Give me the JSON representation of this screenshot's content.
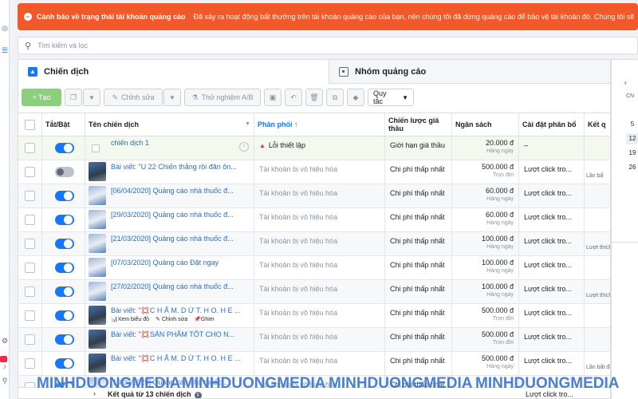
{
  "alert": {
    "title": "Cảnh báo về trạng thái tài khoản quảng cáo",
    "message": "Đã xảy ra hoạt động bất thường trên tài khoản quảng cáo của bạn, nên chúng tôi đã dừng quảng cáo để bảo vệ tài khoản đó. Chúng tôi sẽ"
  },
  "search": {
    "placeholder": "Tìm kiếm và lọc"
  },
  "tabs": {
    "campaigns": "Chiến dịch",
    "ad_sets": "Nhóm quảng cáo"
  },
  "toolbar": {
    "create": "+ Tạo",
    "edit": "Chỉnh sửa",
    "ab_test": "Thử nghiệm A/B",
    "rules": "Quy tắc"
  },
  "columns": {
    "on_off": "Tắt/Bật",
    "name": "Tên chiến dịch",
    "delivery": "Phân phối ↑",
    "bid": "Chiến lược giá thầu",
    "budget": "Ngân sách",
    "optimization": "Cài đặt phân bổ",
    "results": "Kết q"
  },
  "rows": [
    {
      "name": "chiến dịch 1",
      "sub": "",
      "delivery": "Lỗi thiết lập",
      "delivery_error": true,
      "bid": "Giới hạn giá thầu",
      "budget": "20.000 đ",
      "budget_type": "Hàng ngày",
      "opt": "–",
      "result": "",
      "toggle": "on",
      "thumb": "draft"
    },
    {
      "name": "Bài viết: \"U 22 Chiến thắng rồi đăn ôn...",
      "sub": "",
      "delivery": "Tài khoản bị vô hiệu hóa",
      "delivery_error": false,
      "bid": "Chi phí thấp nhất",
      "budget": "500.000 đ",
      "budget_type": "Trọn đời",
      "opt": "Lượt click tro...",
      "result": "Lần bấ",
      "toggle": "off",
      "thumb": "dark"
    },
    {
      "name": "[06/04/2020] Quảng cáo nhà thuốc đ...",
      "sub": "",
      "delivery": "Tài khoản bị vô hiệu hóa",
      "delivery_error": false,
      "bid": "Chi phí thấp nhất",
      "budget": "60.000 đ",
      "budget_type": "Hàng ngày",
      "opt": "Lượt click tro...",
      "result": "",
      "toggle": "on",
      "thumb": "light"
    },
    {
      "name": "[29/03/2020] Quảng cáo nhà thuốc đ...",
      "sub": "",
      "delivery": "Tài khoản bị vô hiệu hóa",
      "delivery_error": false,
      "bid": "Chi phí thấp nhất",
      "budget": "60.000 đ",
      "budget_type": "Hàng ngày",
      "opt": "Lượt click tro...",
      "result": "",
      "toggle": "on",
      "thumb": "light"
    },
    {
      "name": "[21/03/2020] Quảng cáo nhà thuốc đ...",
      "sub": "",
      "delivery": "Tài khoản bị vô hiệu hóa",
      "delivery_error": false,
      "bid": "Chi phí thấp nhất",
      "budget": "100.000 đ",
      "budget_type": "Hàng ngày",
      "opt": "Lượt click tro...",
      "result": "Lượt thích",
      "toggle": "on",
      "thumb": "light"
    },
    {
      "name": "[07/03/2020] Quảng cáo Đặt ngay",
      "sub": "",
      "delivery": "Tài khoản bị vô hiệu hóa",
      "delivery_error": false,
      "bid": "Chi phí thấp nhất",
      "budget": "100.000 đ",
      "budget_type": "Hàng ngày",
      "opt": "Lượt click tro...",
      "result": "",
      "toggle": "on",
      "thumb": "light"
    },
    {
      "name": "[27/02/2020] Quảng cáo nhà thuốc đ...",
      "sub": "",
      "delivery": "Tài khoản bị vô hiệu hóa",
      "delivery_error": false,
      "bid": "Chi phí thấp nhất",
      "budget": "100.000 đ",
      "budget_type": "Hàng ngày",
      "opt": "Lượt click tro...",
      "result": "Lượt thích",
      "toggle": "on",
      "thumb": "light"
    },
    {
      "name": "Bài viết: \"💢C H Ấ M. D Ứ T. H O. H E ...",
      "sub_view": "Xem biểu đồ",
      "sub_edit": "Chỉnh sửa",
      "sub_pin": "Ghim",
      "delivery": "Tài khoản bị vô hiệu hóa",
      "delivery_error": false,
      "bid": "Chi phí thấp nhất",
      "budget": "500.000 đ",
      "budget_type": "Trọn đời",
      "opt": "Lượt click tro...",
      "result": "",
      "toggle": "on",
      "thumb": "dark"
    },
    {
      "name": "Bài viết: \"💢SẢN PHẨM TỐT CHO N...",
      "sub": "",
      "delivery": "Tài khoản bị vô hiệu hóa",
      "delivery_error": false,
      "bid": "Chi phí thấp nhất",
      "budget": "500.000 đ",
      "budget_type": "Trọn đời",
      "opt": "Lượt click tro...",
      "result": "",
      "toggle": "on",
      "thumb": "dark"
    },
    {
      "name": "Bài viết: \"💢C H Ấ M. D Ứ T. H O. H E ...",
      "sub": "",
      "delivery": "Tài khoản bị vô hiệu hóa",
      "delivery_error": false,
      "bid": "Chi phí thấp nhất",
      "budget": "500.000 đ",
      "budget_type": "Hàng ngày",
      "opt": "Lượt click tro...",
      "result": "Lần bắt đầu cuộ",
      "toggle": "on",
      "thumb": "dark"
    },
    {
      "name": "[10/02/2020] Quảng cáo nhà thuốc...",
      "sub": "",
      "delivery": "Tài khoản bị vô hiệu hóa",
      "delivery_error": false,
      "bid": "Chi phí thấp nhất",
      "budget": "",
      "budget_type": "",
      "opt": "",
      "result": "",
      "toggle": "on",
      "thumb": "light"
    }
  ],
  "footer": {
    "total": "Kết quả từ 13 chiến dịch",
    "opt": "Lượt click tro..."
  },
  "calendar": {
    "cn": "CN",
    "days": [
      "5",
      "12",
      "19",
      "26"
    ]
  },
  "watermark": [
    "MINHDUONGMEDIA",
    "MINHDUONGMEDIA",
    "MINHDUONGMEDIA",
    "MINHDUONGMEDIA"
  ]
}
